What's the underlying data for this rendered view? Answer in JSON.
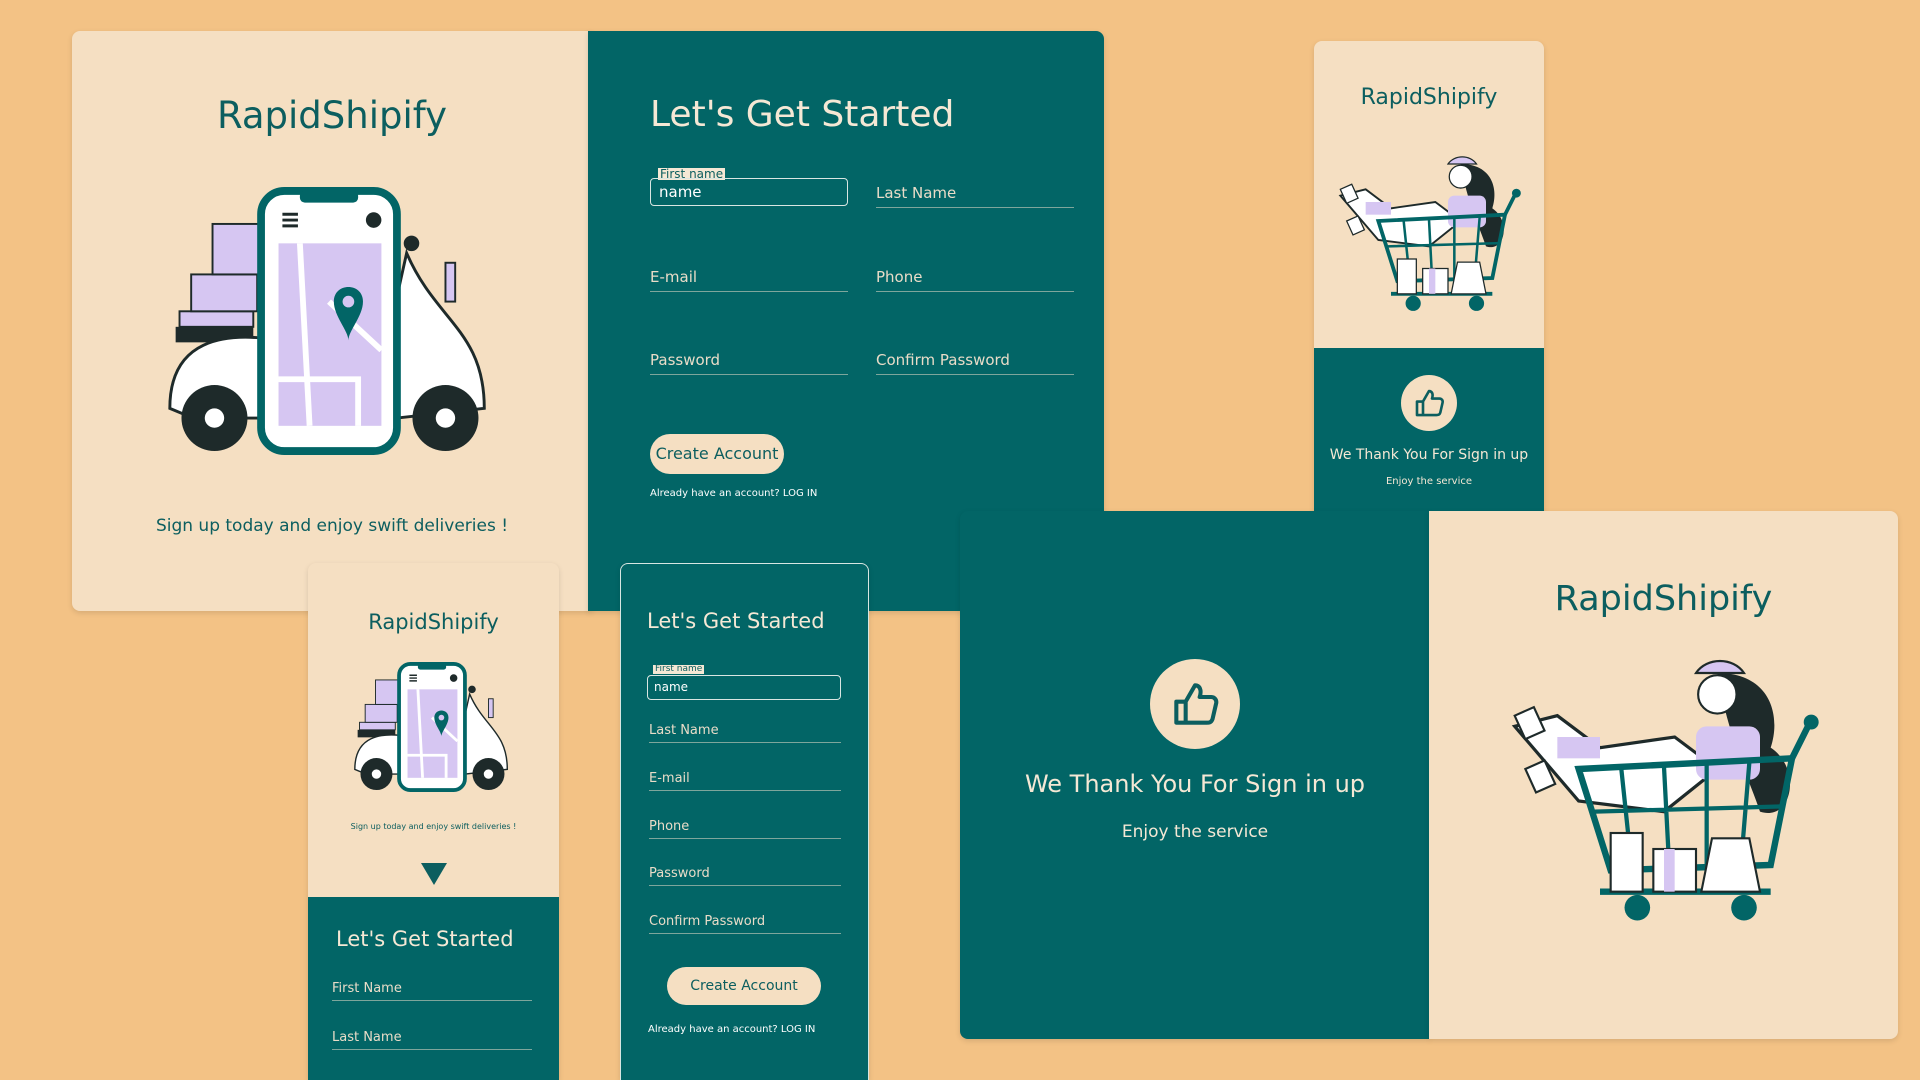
{
  "brand": "RapidShipify",
  "tagline": "Sign up today and enjoy swift deliveries !",
  "form": {
    "heading": "Let's Get Started",
    "first_name_label": "First name",
    "first_name_value": "name",
    "first_name_placeholder": "First Name",
    "last_name": "Last Name",
    "email": "E-mail",
    "phone": "Phone",
    "password": "Password",
    "confirm_password": "Confirm Password",
    "create_button": "Create Account",
    "login_prompt": "Already have an account? LOG IN"
  },
  "thanks": {
    "title": "We Thank You For Sign in up",
    "subtitle": "Enjoy the service"
  },
  "colors": {
    "background": "#f3c285",
    "cream": "#f5dfc2",
    "teal": "#026566",
    "lavender": "#d6c6f2"
  },
  "icons": [
    "scooter-phone-map-illustration",
    "shopping-cart-woman-illustration",
    "thumbs-up-icon",
    "down-arrow-icon"
  ]
}
